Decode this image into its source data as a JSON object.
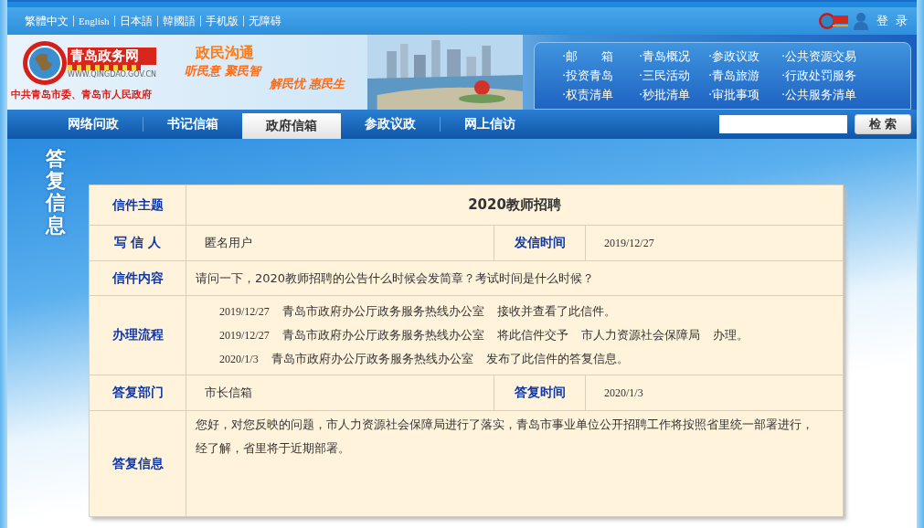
{
  "top_bar": {
    "languages": [
      {
        "label": "繁體中文"
      },
      {
        "label": "English"
      },
      {
        "label": "日本語"
      },
      {
        "label": "韓國語"
      },
      {
        "label": "手机版"
      },
      {
        "label": "无障碍"
      }
    ],
    "login": "登 录"
  },
  "banner": {
    "site_name": "青岛政务网",
    "site_url": "WWW.QINGDAO.GOV.CN",
    "org": "中共青岛市委、青岛市人民政府",
    "slogan_title": "政民沟通",
    "slogans": [
      "听民意 聚民智",
      "解民忧 惠民生"
    ],
    "links": [
      "·邮　　箱",
      "·青岛概况",
      "·参政议政",
      "·公共资源交易",
      "·投资青岛",
      "·三民活动",
      "·青岛旅游",
      "·行政处罚服务",
      "·权责清单",
      "·秒批清单",
      "·审批事项",
      "·公共服务清单"
    ]
  },
  "nav": {
    "tabs": [
      {
        "label": "网络问政",
        "selected": false
      },
      {
        "label": "书记信箱",
        "selected": false
      },
      {
        "label": "政府信箱",
        "selected": true
      },
      {
        "label": "参政议政",
        "selected": false
      },
      {
        "label": "网上信访",
        "selected": false
      }
    ],
    "search_button": "检 索"
  },
  "section_title": "答复信息",
  "letter": {
    "subject_label": "信件主题",
    "subject": "2020教师招聘",
    "writer_label": "写 信 人",
    "writer": "匿名用户",
    "sent_label": "发信时间",
    "sent": "2019/12/27",
    "content_label": "信件内容",
    "content": "请问一下，2020教师招聘的公告什么时候会发简章？考试时间是什么时候？",
    "process_label": "办理流程",
    "process": [
      {
        "date": "2019/12/27",
        "parts": [
          "青岛市政府办公厅政务服务热线办公室",
          "接收并查看了此信件。"
        ]
      },
      {
        "date": "2019/12/27",
        "parts": [
          "青岛市政府办公厅政务服务热线办公室",
          "将此信件交予",
          "市人力资源社会保障局",
          "办理。"
        ]
      },
      {
        "date": "2020/1/3",
        "parts": [
          "青岛市政府办公厅政务服务热线办公室",
          "发布了此信件的答复信息。"
        ]
      }
    ],
    "dept_label": "答复部门",
    "dept": "市长信箱",
    "reply_time_label": "答复时间",
    "reply_time": "2020/1/3",
    "reply_label": "答复信息",
    "reply": "您好，对您反映的问题，市人力资源社会保障局进行了落实，青岛市事业单位公开招聘工作将按照省里统一部署进行，经了解，省里将于近期部署。"
  }
}
